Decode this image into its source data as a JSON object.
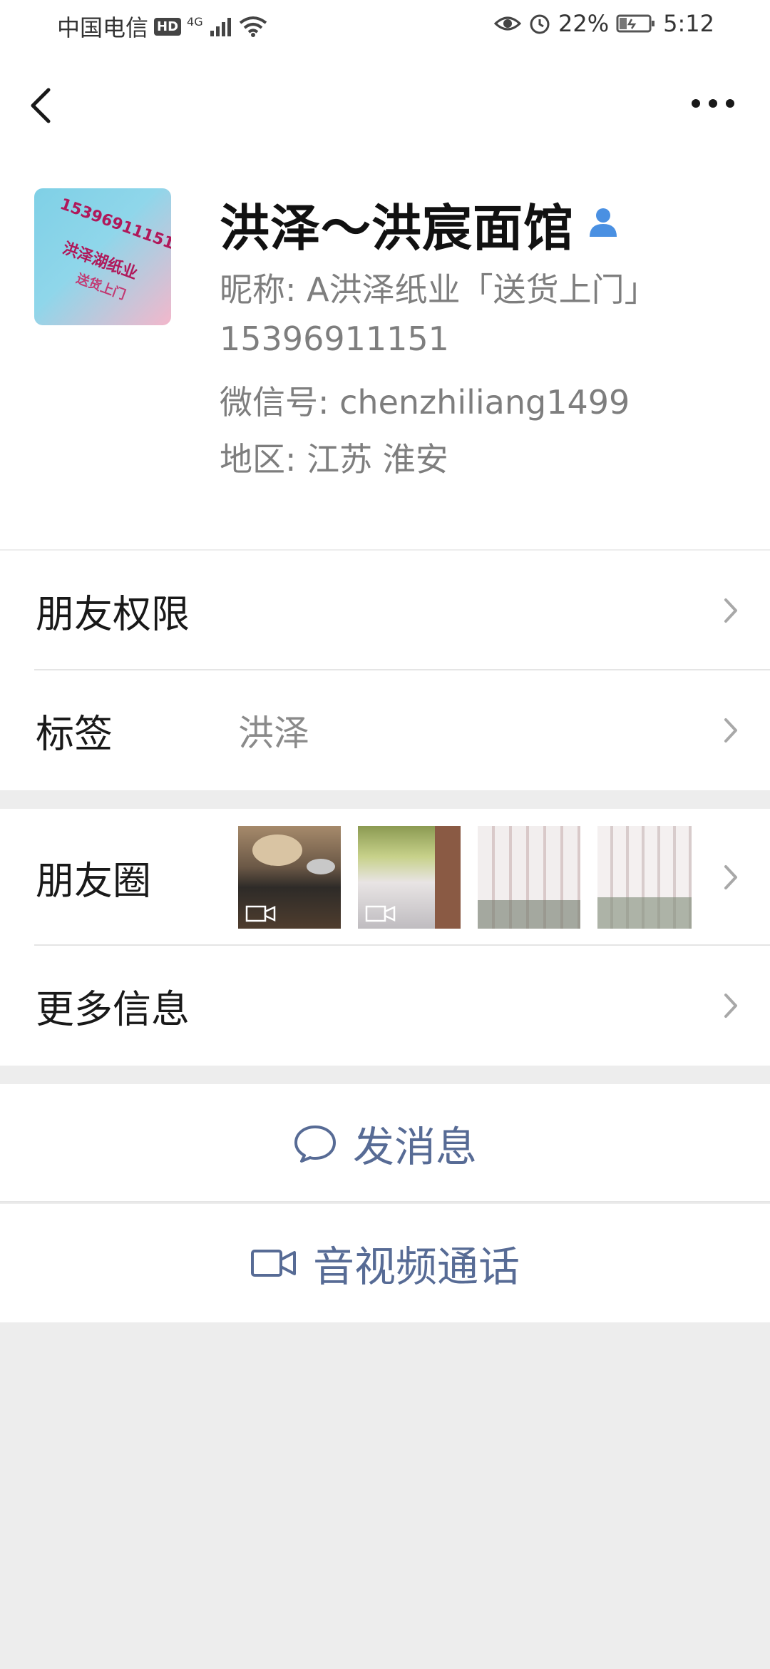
{
  "status_bar": {
    "carrier": "中国电信",
    "hd": "HD",
    "network": "4G",
    "battery": "22%",
    "time": "5:12",
    "icons": [
      "signal-icon",
      "wifi-icon",
      "eye-icon",
      "alarm-icon",
      "battery-icon"
    ]
  },
  "profile": {
    "name": "洪泽～洪宸面馆",
    "nickname": "昵称: A洪泽纸业「送货上门」",
    "phone": "15396911151",
    "wechat_id": "微信号: chenzhiliang1499",
    "region": "地区: 江苏  淮安",
    "avatar_text": [
      "15396911151",
      "洪泽湖纸业",
      "送货上门"
    ]
  },
  "rows": {
    "permissions": "朋友权限",
    "tags_label": "标签",
    "tags_value": "洪泽",
    "moments": "朋友圈",
    "more_info": "更多信息"
  },
  "actions": {
    "message": "发消息",
    "call": "音视频通话"
  },
  "colors": {
    "link": "#576b95",
    "page_bg": "#ededed",
    "badge_blue": "#4a90e2"
  }
}
